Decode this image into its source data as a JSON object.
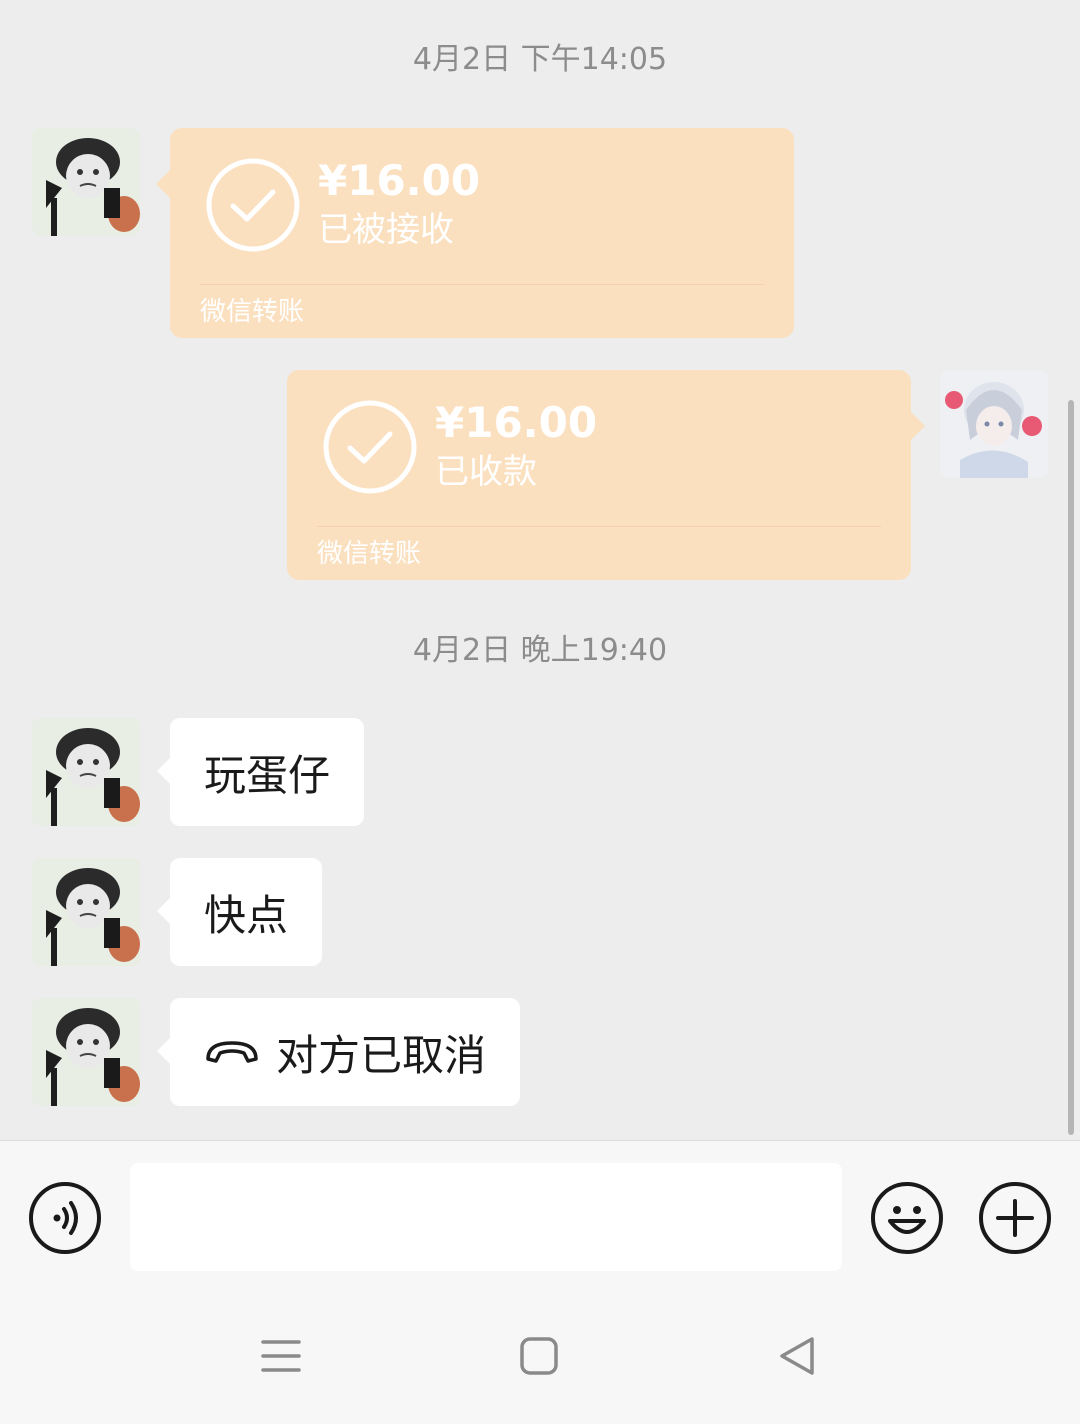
{
  "chat": {
    "timestamp_1": "4月2日 下午14:05",
    "timestamp_2": "4月2日 晚上19:40",
    "transfer_received": {
      "amount": "¥16.00",
      "status": "已被接收",
      "footer": "微信转账"
    },
    "transfer_sent": {
      "amount": "¥16.00",
      "status": "已收款",
      "footer": "微信转账"
    },
    "messages": [
      {
        "text": "玩蛋仔"
      },
      {
        "text": "快点"
      },
      {
        "text": "对方已取消",
        "icon": "hangup-icon"
      }
    ]
  },
  "input": {
    "value": "",
    "placeholder": ""
  },
  "icons": {
    "voice": "voice-icon",
    "emoji": "emoji-icon",
    "plus": "plus-icon",
    "check": "check-circle-icon",
    "nav_menu": "menu-icon",
    "nav_home": "home-icon",
    "nav_back": "back-icon"
  },
  "colors": {
    "chat_background": "#ededed",
    "transfer_card": "#fbe0c0",
    "bubble": "#ffffff",
    "timestamp_text": "#8c8c8c"
  }
}
